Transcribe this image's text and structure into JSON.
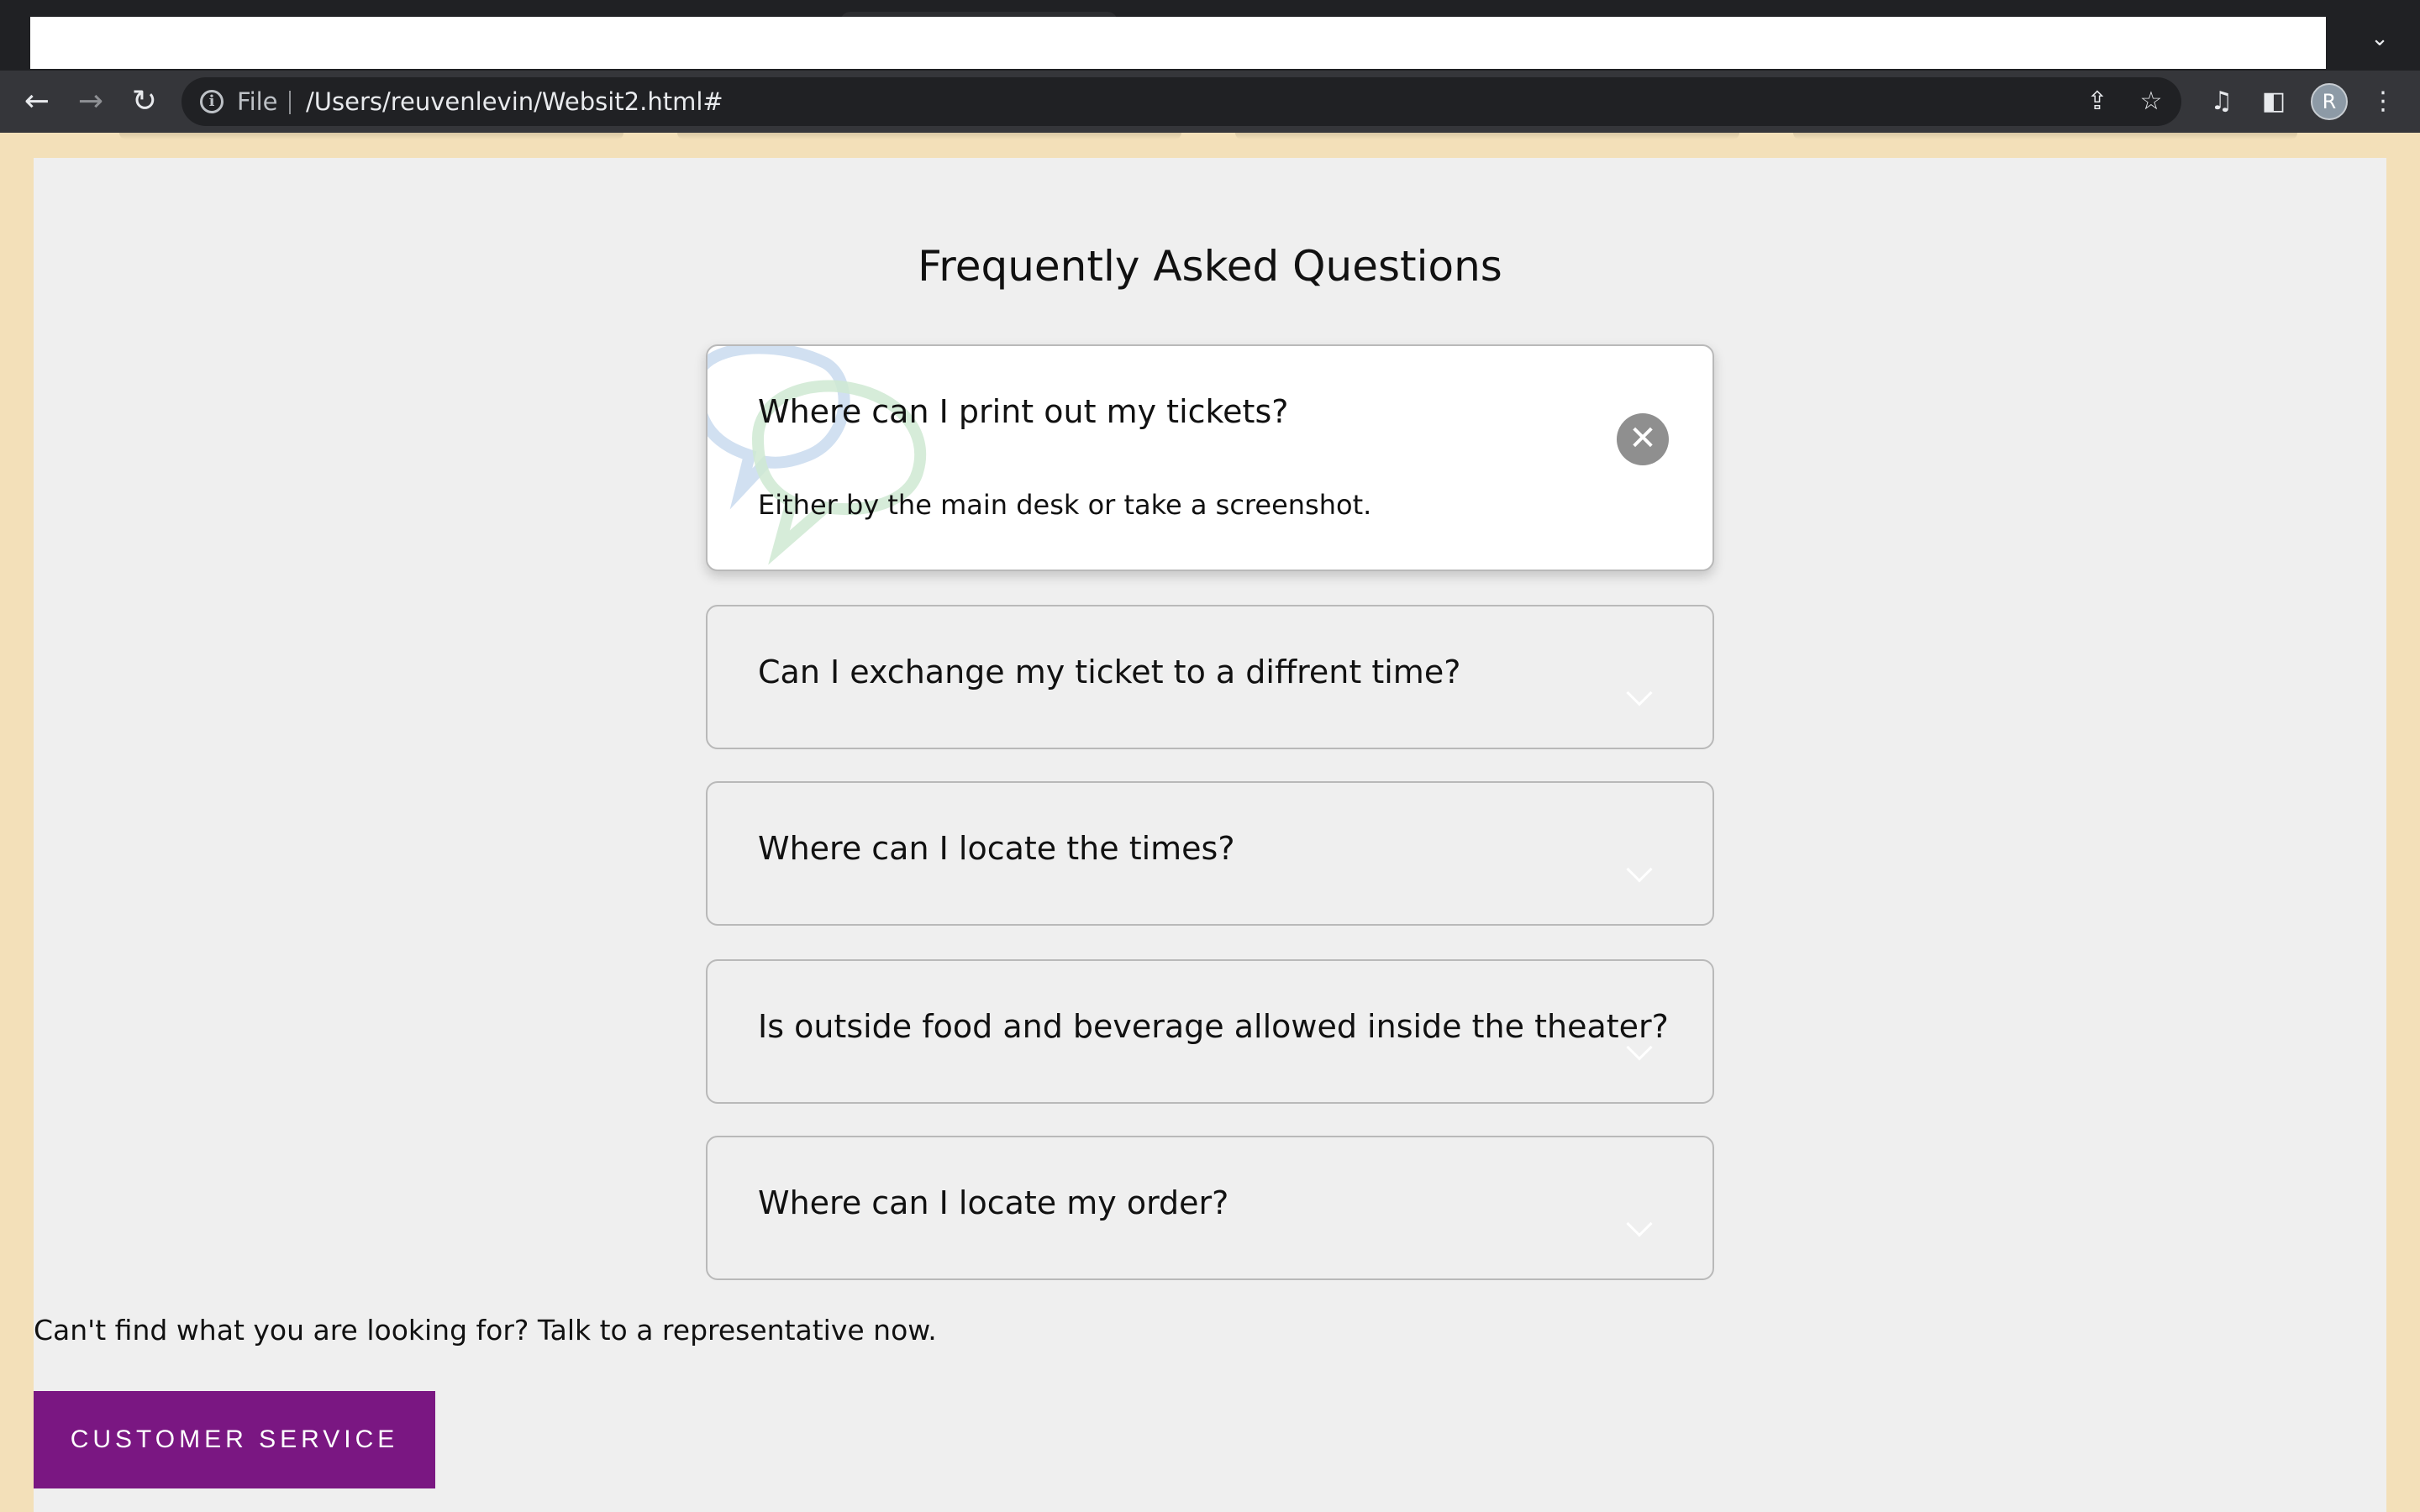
{
  "browser": {
    "omnibox": {
      "scheme_label": "File",
      "url": "/Users/reuvenlevin/Websit2.html#"
    },
    "profile_initial": "R",
    "icons": [
      "back-icon",
      "forward-icon",
      "reload-icon",
      "info-icon",
      "share-icon",
      "star-icon",
      "media-icon",
      "side-panel-icon",
      "menu-icon",
      "tab-list-icon"
    ]
  },
  "faq": {
    "title": "Frequently Asked Questions",
    "items": [
      {
        "question": "Where can I print out my tickets?",
        "answer": "Either by the main desk or take a screenshot.",
        "open": true
      },
      {
        "question": "Can I exchange my ticket to a diffrent time?",
        "open": false
      },
      {
        "question": "Where can I locate the times?",
        "open": false
      },
      {
        "question": "Is outside food and beverage allowed inside the theater?",
        "open": false
      },
      {
        "question": "Where can I locate my order?",
        "open": false
      }
    ]
  },
  "help": {
    "text": "Can't find what you are looking for? Talk to a representative now.",
    "button_label": "CUSTOMER SERVICE"
  },
  "colors": {
    "page_background": "#f3e0b9",
    "panel_background": "#efefef",
    "button_background": "#7a1782",
    "close_button": "#8f8f8f"
  }
}
